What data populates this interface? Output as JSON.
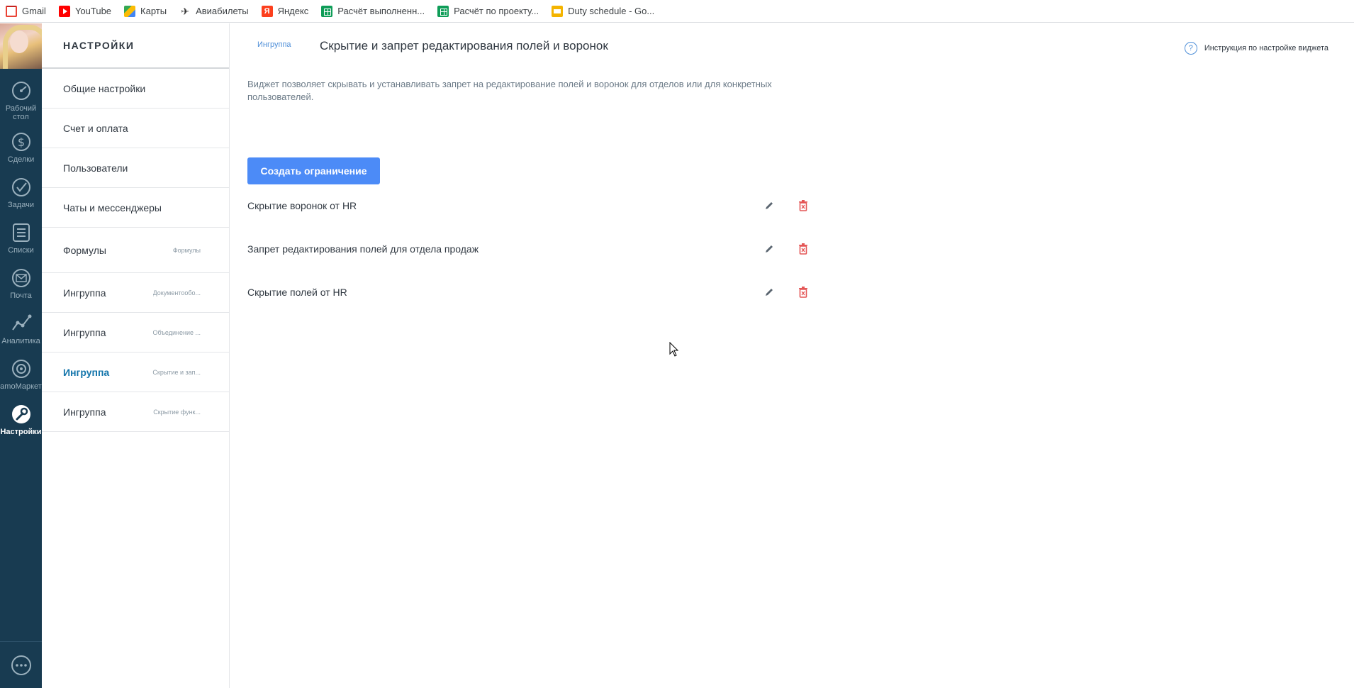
{
  "bookmarks": [
    {
      "label": "Gmail",
      "icon": "gmail-icon"
    },
    {
      "label": "YouTube",
      "icon": "youtube-icon"
    },
    {
      "label": "Карты",
      "icon": "maps-icon"
    },
    {
      "label": "Авиабилеты",
      "icon": "plane-icon"
    },
    {
      "label": "Яндекс",
      "icon": "yandex-icon"
    },
    {
      "label": "Расчёт выполненн...",
      "icon": "sheets-icon"
    },
    {
      "label": "Расчёт по проекту...",
      "icon": "sheets-icon"
    },
    {
      "label": "Duty schedule - Go...",
      "icon": "slides-icon"
    }
  ],
  "leftnav": {
    "items": [
      {
        "label_line1": "Рабочий",
        "label_line2": "стол",
        "icon": "dashboard-icon"
      },
      {
        "label_line1": "Сделки",
        "label_line2": "",
        "icon": "dollar-icon"
      },
      {
        "label_line1": "Задачи",
        "label_line2": "",
        "icon": "check-circle-icon"
      },
      {
        "label_line1": "Списки",
        "label_line2": "",
        "icon": "list-icon"
      },
      {
        "label_line1": "Почта",
        "label_line2": "",
        "icon": "mail-icon"
      },
      {
        "label_line1": "Аналитика",
        "label_line2": "",
        "icon": "analytics-icon"
      },
      {
        "label_line1": "amoМаркет",
        "label_line2": "",
        "icon": "market-icon"
      },
      {
        "label_line1": "Настройки",
        "label_line2": "",
        "icon": "wrench-icon",
        "active": true
      }
    ],
    "chat_icon": "chat-dots-icon"
  },
  "settings": {
    "title": "НАСТРОЙКИ",
    "items": [
      {
        "label": "Общие настройки",
        "sub": ""
      },
      {
        "label": "Счет и оплата",
        "sub": ""
      },
      {
        "label": "Пользователи",
        "sub": ""
      },
      {
        "label": "Чаты и мессенджеры",
        "sub": ""
      },
      {
        "label": "Формулы",
        "sub": "Формулы"
      },
      {
        "label": "Ингруппа",
        "sub": "Документообо..."
      },
      {
        "label": "Ингруппа",
        "sub": "Объединение ..."
      },
      {
        "label": "Ингруппа",
        "sub": "Скрытие и зап...",
        "active": true
      },
      {
        "label": "Ингруппа",
        "sub": "Скрытие функ..."
      }
    ]
  },
  "main": {
    "breadcrumb": "Ингруппа",
    "title": "Скрытие и запрет редактирования полей и воронок",
    "help_label": "Инструкция по настройке виджета",
    "help_icon": "?",
    "description": "Виджет позволяет скрывать и устанавливать запрет на редактирование полей и воронок для отделов или для конкретных пользователей.",
    "create_button": "Создать ограничение",
    "rules": [
      {
        "name": "Скрытие воронок от HR"
      },
      {
        "name": "Запрет редактирования полей для отдела продаж"
      },
      {
        "name": "Скрытие полей от HR"
      }
    ]
  },
  "colors": {
    "nav_bg": "#183b51",
    "accent_blue": "#4c8bf7",
    "active_menu": "#1375ab",
    "delete_red": "#e45757"
  }
}
